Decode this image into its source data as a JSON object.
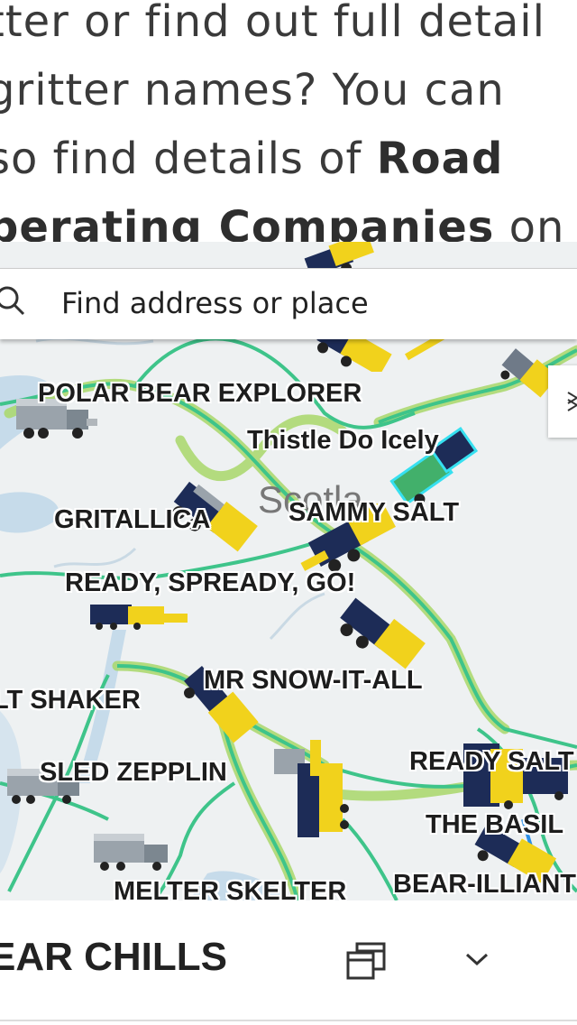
{
  "article": {
    "line1": "tter or find out full detail",
    "line2": "gritter names? You can",
    "line3_pre": "so find details of ",
    "line3_bold": "Road",
    "line4_bold": "perating Companies",
    "line4_post": " on"
  },
  "search": {
    "placeholder": "Find address or place"
  },
  "map": {
    "place_label": "Scotland",
    "gritters": [
      "POLAR BEAR EXPLORER",
      "Thistle Do Icely",
      "GRITALLICA",
      "SAMMY SALT",
      "READY, SPREADY, GO!",
      "MR SNOW-IT-ALL",
      "LT SHAKER",
      "SLED ZEPPLIN",
      "READY SALT",
      "THE BASIL",
      "MELTER SKELTER",
      "BEAR-ILLIANT"
    ]
  },
  "footer": {
    "title": "EAR CHILLS"
  },
  "colors": {
    "road": "#3ec48a",
    "route_highlight": "#a9d86a",
    "water": "#c6dbea",
    "truck_yellow": "#f1d21c",
    "truck_blue": "#1d2c57"
  }
}
